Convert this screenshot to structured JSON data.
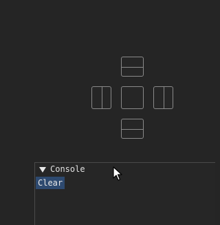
{
  "dock_overlay": {
    "targets": [
      "top",
      "left",
      "center",
      "right",
      "bottom"
    ]
  },
  "console": {
    "title": "Console",
    "collapse_icon": "triangle-down-icon",
    "clear_label": "Clear"
  },
  "cursor": {
    "icon": "arrow-pointer-icon"
  },
  "colors": {
    "background": "#252525",
    "dock_outline": "#8a8a8a",
    "button_bg": "#2e4a70",
    "text": "#e0e0e0"
  }
}
